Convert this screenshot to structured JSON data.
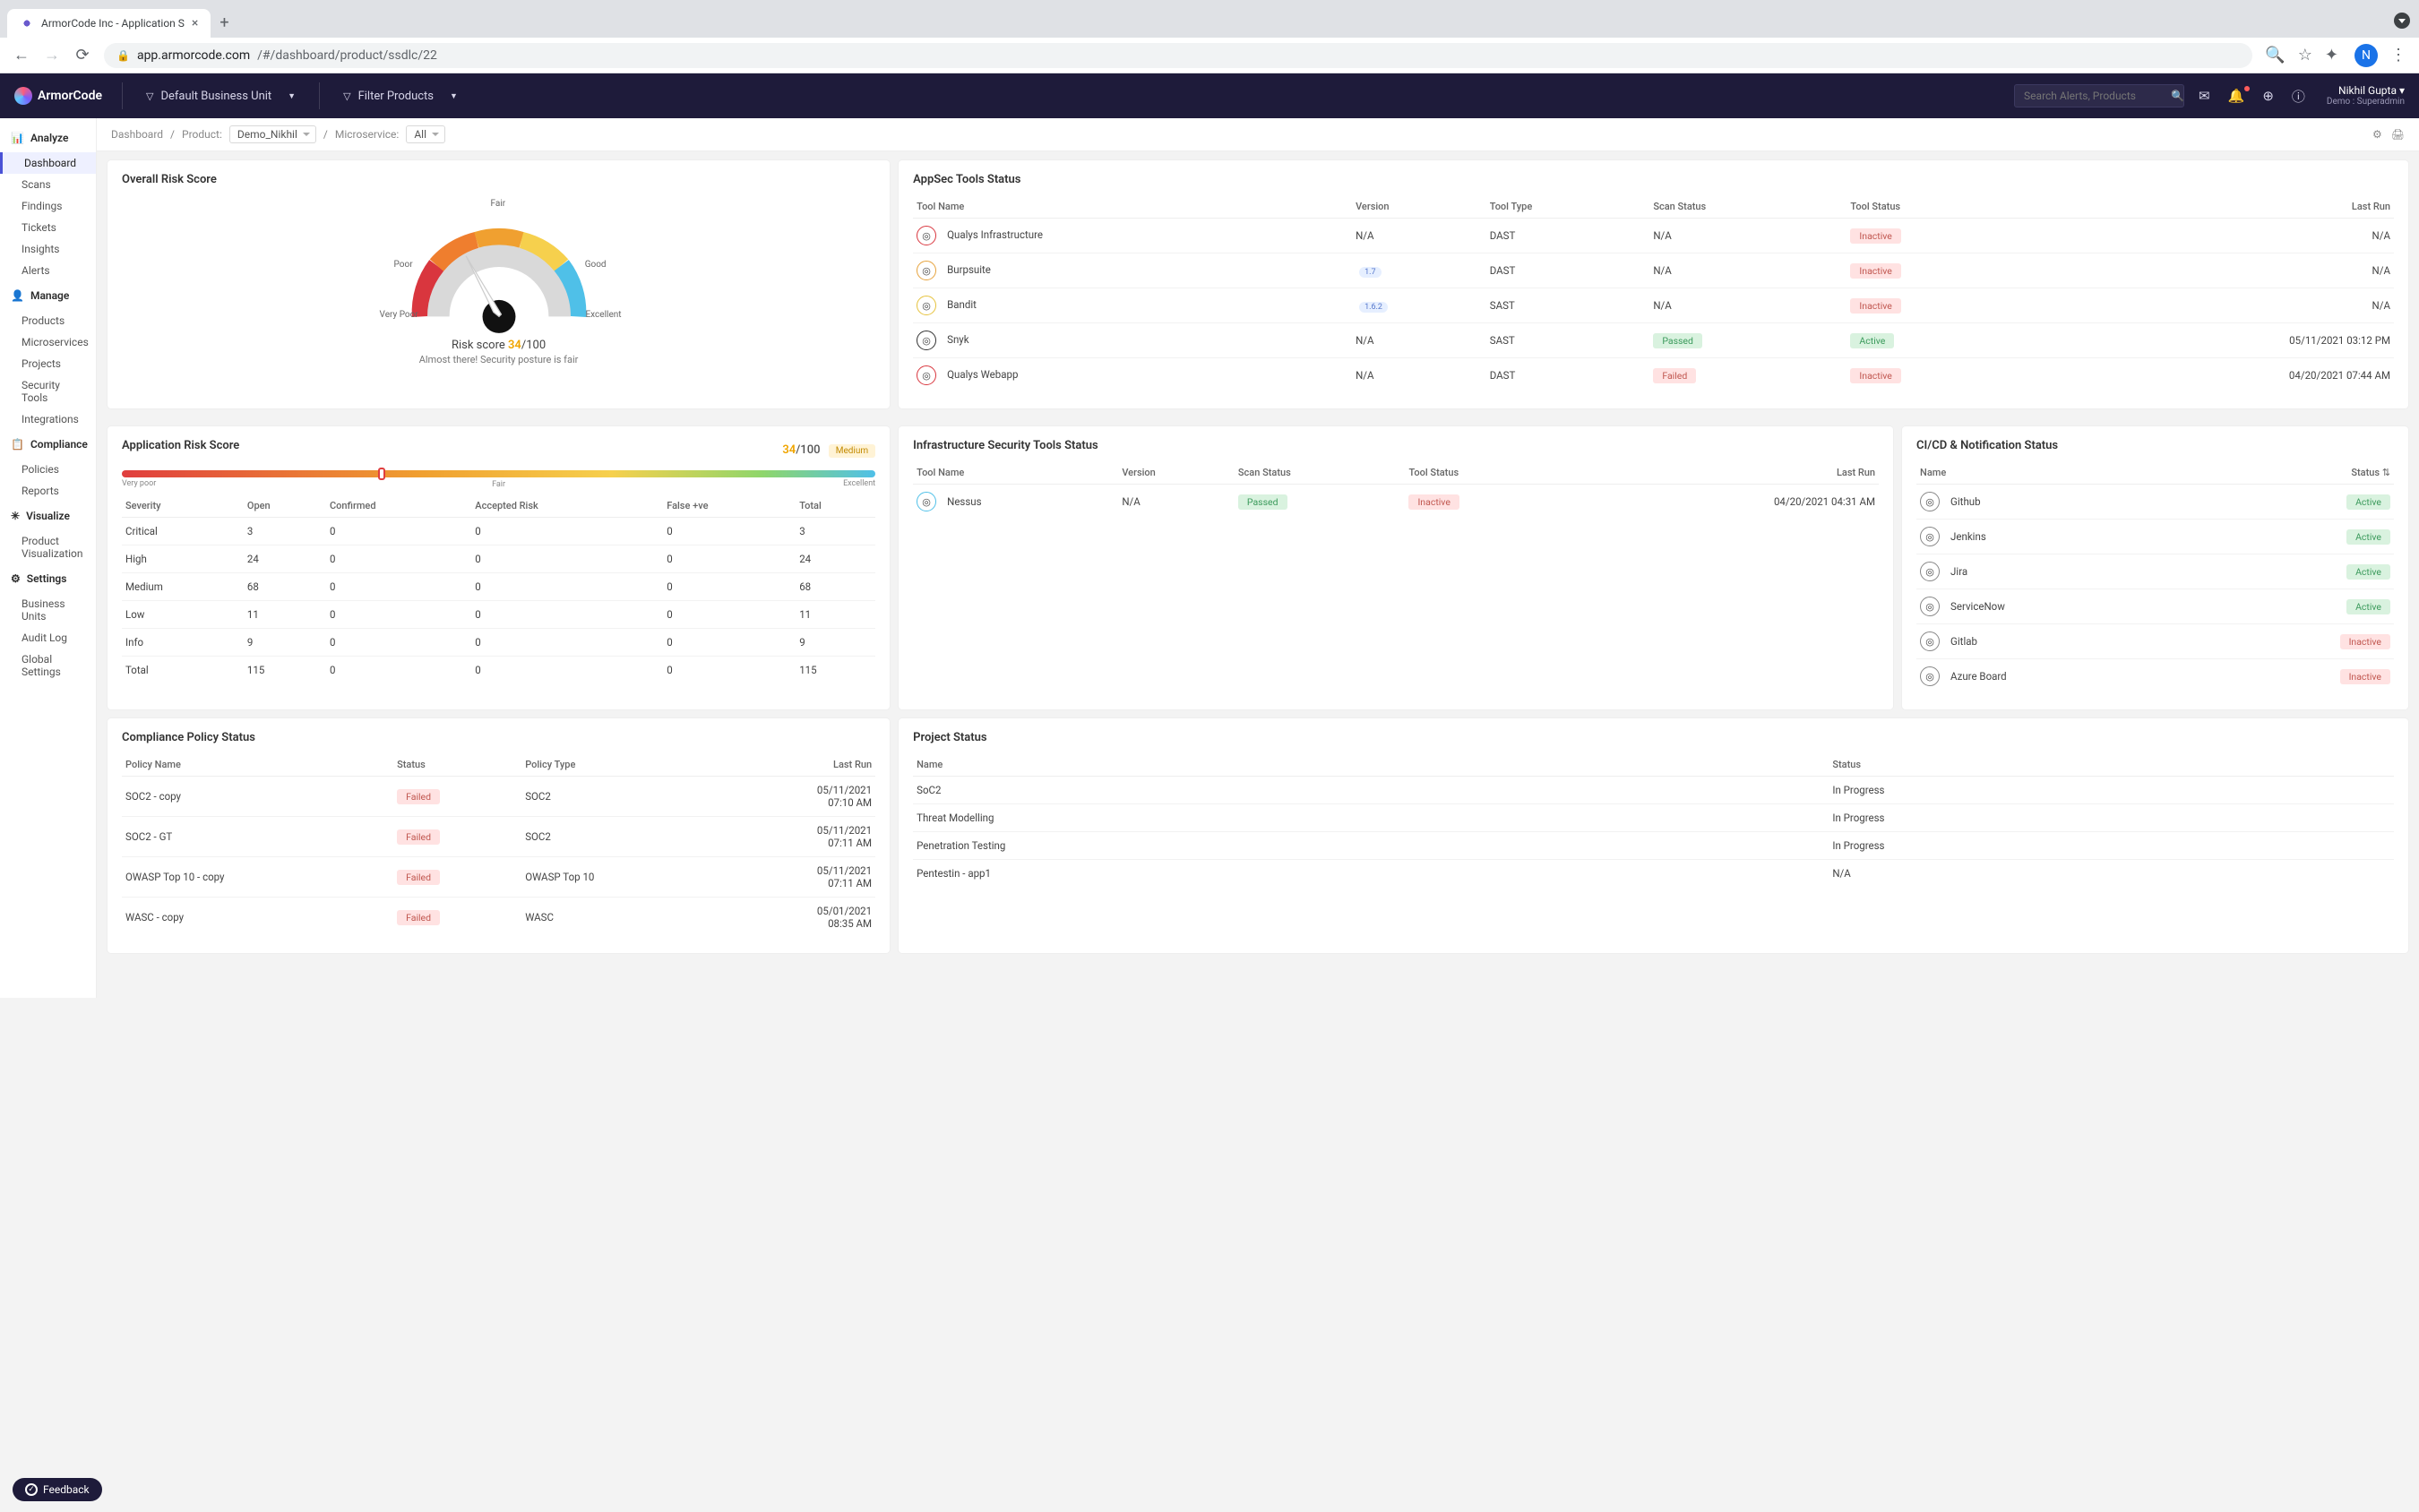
{
  "browser": {
    "tab_title": "ArmorCode Inc - Application S",
    "url_domain": "app.armorcode.com",
    "url_path": "/#/dashboard/product/ssdlc/22",
    "avatar_letter": "N"
  },
  "header": {
    "brand": "ArmorCode",
    "filter_bu": "Default Business Unit",
    "filter_products": "Filter Products",
    "search_placeholder": "Search Alerts, Products",
    "user_name": "Nikhil Gupta",
    "user_role": "Demo : Superadmin"
  },
  "sidebar": {
    "groups": [
      {
        "label": "Analyze",
        "items": [
          "Dashboard",
          "Scans",
          "Findings",
          "Tickets",
          "Insights",
          "Alerts"
        ],
        "active_item": "Dashboard"
      },
      {
        "label": "Manage",
        "items": [
          "Products",
          "Microservices",
          "Projects",
          "Security Tools",
          "Integrations"
        ]
      },
      {
        "label": "Compliance",
        "items": [
          "Policies",
          "Reports"
        ]
      },
      {
        "label": "Visualize",
        "items": [
          "Product Visualization"
        ]
      },
      {
        "label": "Settings",
        "items": [
          "Business Units",
          "Audit Log",
          "Global Settings"
        ]
      }
    ]
  },
  "breadcrumb": {
    "root": "Dashboard",
    "product_label": "Product:",
    "product_value": "Demo_Nikhil",
    "micro_label": "Microservice:",
    "micro_value": "All"
  },
  "overall_risk": {
    "title": "Overall Risk Score",
    "gauge_labels": {
      "vpoor": "Very Poor",
      "poor": "Poor",
      "fair": "Fair",
      "good": "Good",
      "excellent": "Excellent"
    },
    "score_label": "Risk score",
    "score": "34",
    "score_total": "/100",
    "subtitle": "Almost there! Security posture is fair"
  },
  "appsec": {
    "title": "AppSec Tools Status",
    "columns": [
      "Tool Name",
      "Version",
      "Tool Type",
      "Scan Status",
      "Tool Status",
      "Last Run"
    ],
    "rows": [
      {
        "name": "Qualys Infrastructure",
        "ver": "N/A",
        "type": "DAST",
        "scan": "N/A",
        "tool": "Inactive",
        "last": "N/A",
        "icon_border": "#d9363e"
      },
      {
        "name": "Burpsuite",
        "ver": "1.7",
        "ver_pill": true,
        "type": "DAST",
        "scan": "N/A",
        "tool": "Inactive",
        "last": "N/A",
        "icon_border": "#e6a23c"
      },
      {
        "name": "Bandit",
        "ver": "1.6.2",
        "ver_pill": true,
        "type": "SAST",
        "scan": "N/A",
        "tool": "Inactive",
        "last": "N/A",
        "icon_border": "#e6c23c"
      },
      {
        "name": "Snyk",
        "ver": "N/A",
        "type": "SAST",
        "scan": "Passed",
        "tool": "Active",
        "last": "05/11/2021 03:12 PM",
        "icon_border": "#333"
      },
      {
        "name": "Qualys Webapp",
        "ver": "N/A",
        "type": "DAST",
        "scan": "Failed",
        "tool": "Inactive",
        "last": "04/20/2021 07:44 AM",
        "icon_border": "#d9363e"
      }
    ]
  },
  "app_risk": {
    "title": "Application Risk Score",
    "score": "34",
    "score_total": "/100",
    "pill": "Medium",
    "min": "Very poor",
    "mid": "Fair",
    "max": "Excellent",
    "columns": [
      "Severity",
      "Open",
      "Confirmed",
      "Accepted Risk",
      "False +ve",
      "Total"
    ],
    "rows": [
      {
        "sev": "Critical",
        "cls": "sev-critical",
        "open": "3",
        "conf": "0",
        "acc": "0",
        "fp": "0",
        "total": "3"
      },
      {
        "sev": "High",
        "cls": "sev-high",
        "open": "24",
        "conf": "0",
        "acc": "0",
        "fp": "0",
        "total": "24"
      },
      {
        "sev": "Medium",
        "cls": "sev-medium",
        "open": "68",
        "conf": "0",
        "acc": "0",
        "fp": "0",
        "total": "68"
      },
      {
        "sev": "Low",
        "cls": "sev-low",
        "open": "11",
        "conf": "0",
        "acc": "0",
        "fp": "0",
        "total": "11"
      },
      {
        "sev": "Info",
        "cls": "sev-info",
        "open": "9",
        "conf": "0",
        "acc": "0",
        "fp": "0",
        "total": "9"
      },
      {
        "sev": "Total",
        "cls": "",
        "open": "115",
        "conf": "0",
        "acc": "0",
        "fp": "0",
        "total": "115"
      }
    ]
  },
  "infra": {
    "title": "Infrastructure Security Tools Status",
    "columns": [
      "Tool Name",
      "Version",
      "Scan Status",
      "Tool Status",
      "Last Run"
    ],
    "rows": [
      {
        "name": "Nessus",
        "ver": "N/A",
        "scan": "Passed",
        "tool": "Inactive",
        "last": "04/20/2021 04:31 AM",
        "icon_border": "#4fc0e8"
      }
    ]
  },
  "cicd": {
    "title": "CI/CD & Notification Status",
    "columns": [
      "Name",
      "Status"
    ],
    "rows": [
      {
        "name": "Github",
        "status": "Active"
      },
      {
        "name": "Jenkins",
        "status": "Active"
      },
      {
        "name": "Jira",
        "status": "Active"
      },
      {
        "name": "ServiceNow",
        "status": "Active"
      },
      {
        "name": "Gitlab",
        "status": "Inactive"
      },
      {
        "name": "Azure Board",
        "status": "Inactive"
      }
    ]
  },
  "compliance": {
    "title": "Compliance Policy Status",
    "columns": [
      "Policy Name",
      "Status",
      "Policy Type",
      "Last Run"
    ],
    "rows": [
      {
        "name": "SOC2 - copy",
        "status": "Failed",
        "type": "SOC2",
        "last": "05/11/2021 07:10 AM"
      },
      {
        "name": "SOC2 - GT",
        "status": "Failed",
        "type": "SOC2",
        "last": "05/11/2021 07:11 AM"
      },
      {
        "name": "OWASP Top 10 - copy",
        "status": "Failed",
        "type": "OWASP Top 10",
        "last": "05/11/2021 07:11 AM"
      },
      {
        "name": "WASC - copy",
        "status": "Failed",
        "type": "WASC",
        "last": "05/01/2021 08:35 AM"
      }
    ]
  },
  "projects": {
    "title": "Project Status",
    "columns": [
      "Name",
      "Status"
    ],
    "rows": [
      {
        "name": "SoC2",
        "status": "In Progress"
      },
      {
        "name": "Threat Modelling",
        "status": "In Progress"
      },
      {
        "name": "Penetration Testing",
        "status": "In Progress"
      },
      {
        "name": "Pentestin - app1",
        "status": "N/A"
      }
    ]
  },
  "feedback_label": "Feedback",
  "chart_data": {
    "type": "gauge",
    "title": "Overall Risk Score",
    "value": 34,
    "max": 100,
    "bands": [
      {
        "label": "Very Poor",
        "range": [
          0,
          20
        ],
        "color": "#d9363e"
      },
      {
        "label": "Poor",
        "range": [
          20,
          40
        ],
        "color": "#ef7e2e"
      },
      {
        "label": "Fair",
        "range": [
          40,
          60
        ],
        "color": "#f0a030"
      },
      {
        "label": "Good",
        "range": [
          60,
          80
        ],
        "color": "#f6d04d"
      },
      {
        "label": "Excellent",
        "range": [
          80,
          100
        ],
        "color": "#4fc0e8"
      }
    ]
  }
}
